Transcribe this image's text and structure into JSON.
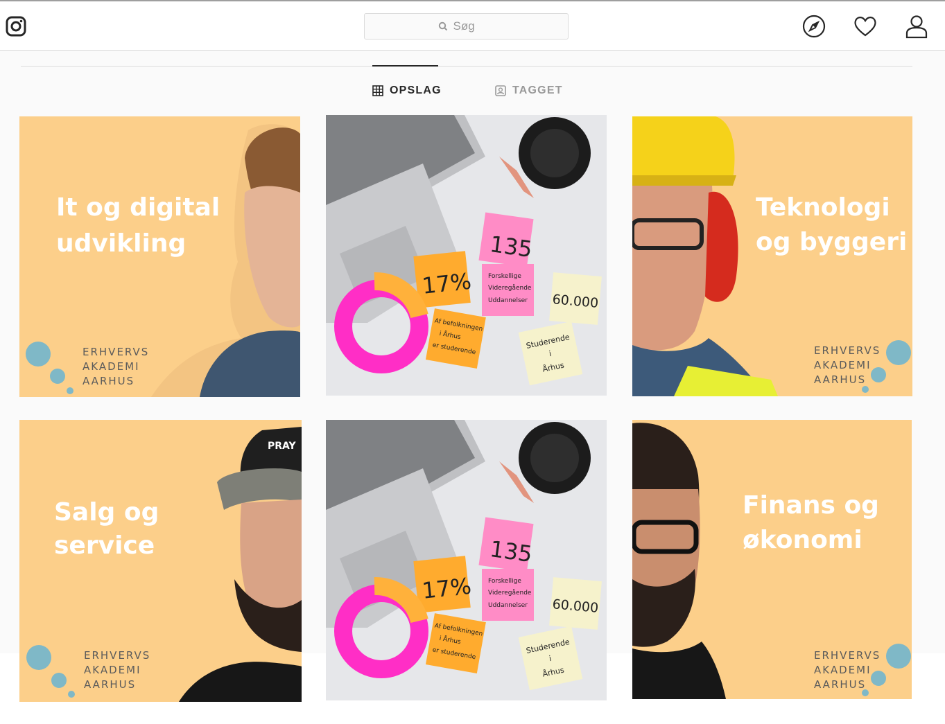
{
  "header": {
    "search_placeholder": "Søg",
    "icons": [
      "instagram-logo-icon",
      "search-icon",
      "compass-icon",
      "heart-icon",
      "person-icon"
    ]
  },
  "tabs": [
    {
      "label": "OPSLAG",
      "icon": "grid-icon",
      "active": true
    },
    {
      "label": "TAGGET",
      "icon": "tagged-person-icon",
      "active": false
    }
  ],
  "posts": [
    {
      "title_line1": "It og digital",
      "title_line2": "udvikling",
      "brand": [
        "ERHVERVS",
        "AKADEMI",
        "AARHUS"
      ]
    },
    {
      "notes": {
        "pink": "135",
        "orange": "17%",
        "pink2": [
          "Forskellige",
          "Videregående",
          "Uddannelser"
        ],
        "yellow": "60.000",
        "orange2": [
          "Af befolkningen",
          "i Århus",
          "er studerende"
        ],
        "yellow2": [
          "Studerende",
          "i",
          "Århus"
        ]
      }
    },
    {
      "title_line1": "Teknologi",
      "title_line2": "og byggeri",
      "brand": [
        "ERHVERVS",
        "AKADEMI",
        "AARHUS"
      ]
    },
    {
      "title_line1": "Salg og",
      "title_line2": "service",
      "brand": [
        "ERHVERVS",
        "AKADEMI",
        "AARHUS"
      ],
      "cap_text": "PRAY"
    },
    {
      "notes": {
        "pink": "135",
        "orange": "17%",
        "pink2": [
          "Forskellige",
          "Videregående",
          "Uddannelser"
        ],
        "yellow": "60.000",
        "orange2": [
          "Af befolkningen",
          "i Århus",
          "er studerende"
        ],
        "yellow2": [
          "Studerende",
          "i",
          "Århus"
        ]
      }
    },
    {
      "title_line1": "Finans og",
      "title_line2": "økonomi",
      "brand": [
        "ERHVERVS",
        "AKADEMI",
        "AARHUS"
      ]
    }
  ],
  "colors": {
    "tile_bg": "#fccf8a",
    "accent_blue": "#7fb8c7",
    "white_text": "#ffffff"
  }
}
